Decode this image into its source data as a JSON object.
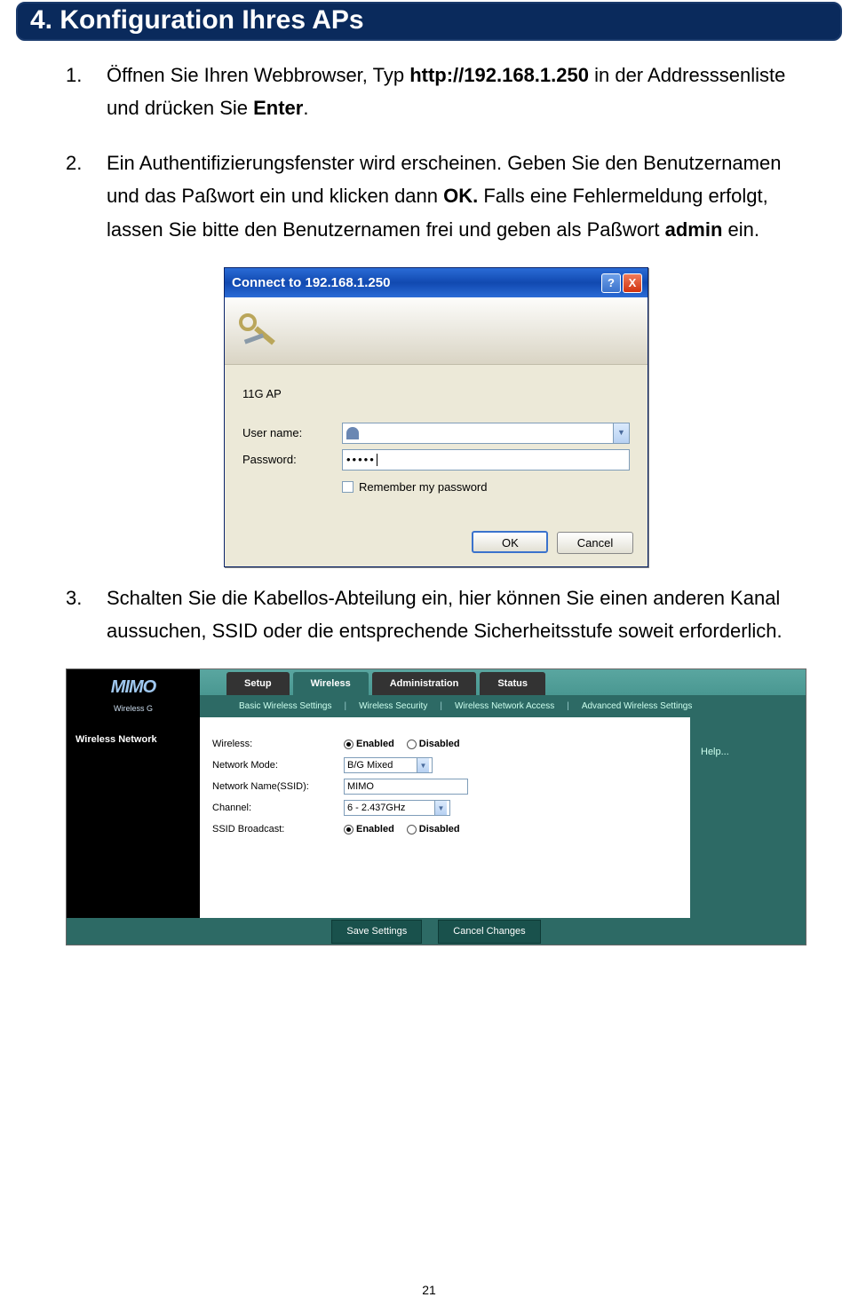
{
  "page": {
    "number": "21"
  },
  "section": {
    "title": "4. Konfiguration Ihres APs"
  },
  "steps": {
    "s1": {
      "num": "1.",
      "t1": "Öffnen Sie Ihren Webbrowser, Typ ",
      "bold1": "http://192.168.1.250",
      "t2": " in der Addresssenliste und drücken Sie ",
      "bold2": "Enter",
      "t3": "."
    },
    "s2": {
      "num": "2.",
      "t1": "Ein Authentifizierungsfenster wird erscheinen. Geben Sie den Benutzernamen und das Paßwort ein und klicken dann ",
      "bold1": "OK.",
      "t2": " Falls eine Fehlermeldung erfolgt, lassen Sie bitte den Benutzernamen frei und geben als Paßwort ",
      "bold2": "admin",
      "t3": " ein."
    },
    "s3": {
      "num": "3.",
      "t1": "Schalten Sie die Kabellos-Abteilung ein, hier können Sie einen anderen Kanal aussuchen, SSID oder die entsprechende Sicherheitsstufe soweit erforderlich."
    }
  },
  "dialog": {
    "title": "Connect to 192.168.1.250",
    "help_glyph": "?",
    "close_glyph": "X",
    "realm": "11G AP",
    "user_label": "User name:",
    "username_value": "",
    "pass_label": "Password:",
    "password_masked": "•••••",
    "remember": "Remember my password",
    "ok": "OK",
    "cancel": "Cancel",
    "chev": "▼"
  },
  "router": {
    "logo_top": "MIMO",
    "logo_sub": "Wireless G",
    "tabs": [
      "Setup",
      "Wireless",
      "Administration",
      "Status"
    ],
    "active_tab_index": 1,
    "subnav": [
      "Basic Wireless Settings",
      "Wireless Security",
      "Wireless Network Access",
      "Advanced Wireless Settings"
    ],
    "side_title": "Wireless Network",
    "help": "Help...",
    "rows": {
      "wireless": {
        "label": "Wireless:",
        "enabled": "Enabled",
        "disabled": "Disabled",
        "value": "Enabled"
      },
      "mode": {
        "label": "Network Mode:",
        "value": "B/G Mixed"
      },
      "ssid": {
        "label": "Network Name(SSID):",
        "value": "MIMO"
      },
      "channel": {
        "label": "Channel:",
        "value": "6 - 2.437GHz"
      },
      "broadcast": {
        "label": "SSID Broadcast:",
        "enabled": "Enabled",
        "disabled": "Disabled",
        "value": "Enabled"
      }
    },
    "save": "Save Settings",
    "cancel": "Cancel Changes",
    "dd": "▼"
  }
}
